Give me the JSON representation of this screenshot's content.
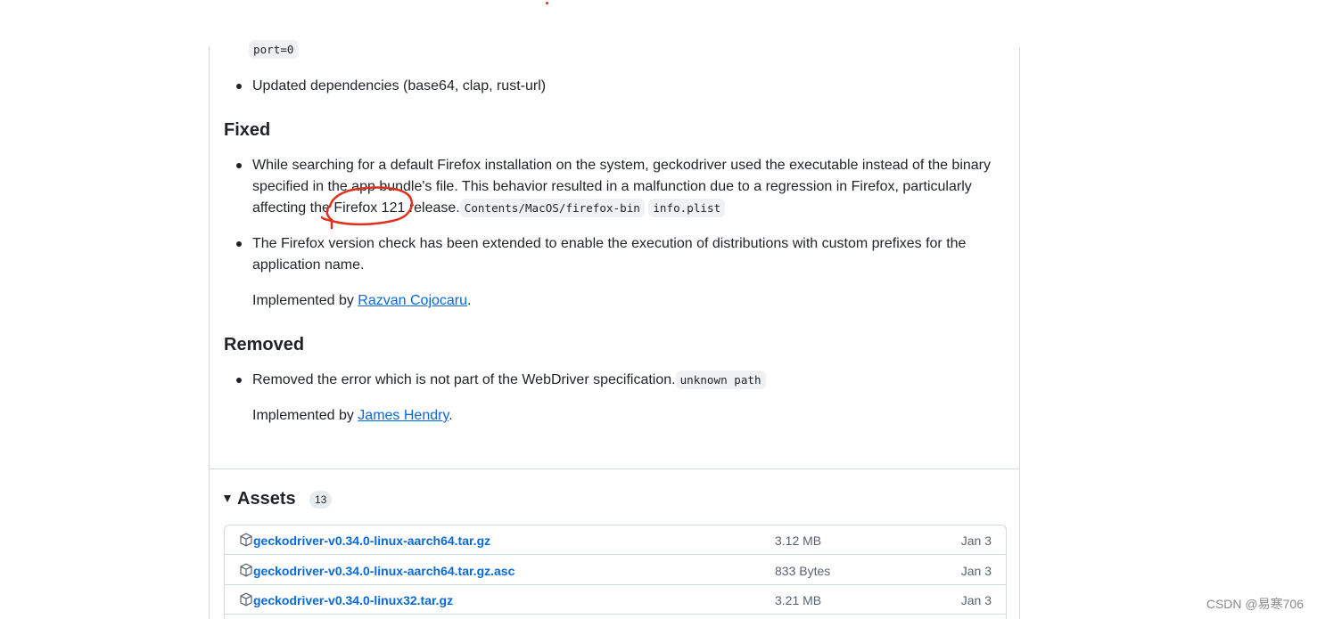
{
  "top_code": "port=0",
  "updated_item": "Updated dependencies (base64, clap, rust-url)",
  "fixed": {
    "heading": "Fixed",
    "item1_line1": "While searching for a default Firefox installation on the system, geckodriver used the executable instead of the binary",
    "item1_line2": "specified in the app bundle's file. This behavior resulted in a malfunction due to a regression in Firefox, particularly",
    "item1_line3_pre": "affecting the Firefox 121 release.",
    "item1_code1": "Contents/MacOS/firefox-bin",
    "item1_code2": "info.plist",
    "item2_line1": "The Firefox version check has been extended to enable the execution of distributions with custom prefixes for the",
    "item2_line2": "application name.",
    "implemented_prefix": "Implemented by",
    "implemented_author": "Razvan Cojocaru",
    "implemented_suffix": "."
  },
  "removed": {
    "heading": "Removed",
    "item1_text": "Removed the error which is not part of the WebDriver specification.",
    "item1_code": "unknown path",
    "implemented_prefix": "Implemented by",
    "implemented_author": "James Hendry",
    "implemented_suffix": "."
  },
  "assets": {
    "title": "Assets",
    "count": "13",
    "files": [
      {
        "name": "geckodriver-v0.34.0-linux-aarch64.tar.gz",
        "size": "3.12 MB",
        "date": "Jan 3",
        "icon": "package-icon"
      },
      {
        "name": "geckodriver-v0.34.0-linux-aarch64.tar.gz.asc",
        "size": "833 Bytes",
        "date": "Jan 3",
        "icon": "package-icon"
      },
      {
        "name": "geckodriver-v0.34.0-linux32.tar.gz",
        "size": "3.21 MB",
        "date": "Jan 3",
        "icon": "package-icon"
      }
    ]
  },
  "watermark": "CSDN @易寒706",
  "colors": {
    "link": "#0969da",
    "annotation": "#e0301e",
    "border": "#d1d9e0"
  }
}
